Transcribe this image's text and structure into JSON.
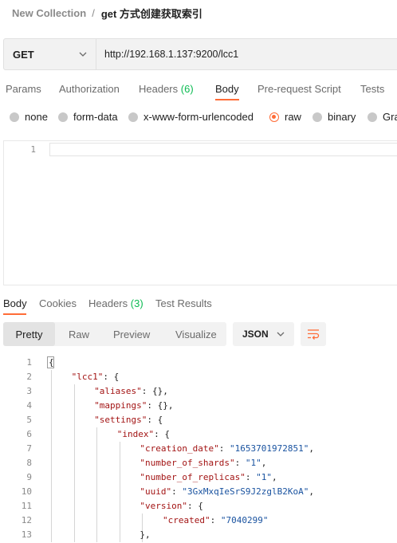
{
  "breadcrumb": {
    "parent": "New Collection",
    "separator": "/",
    "current": "get 方式创建获取索引"
  },
  "request": {
    "method": "GET",
    "url": "http://192.168.1.137:9200/lcc1"
  },
  "request_tabs": [
    {
      "label": "Params"
    },
    {
      "label": "Authorization"
    },
    {
      "label": "Headers",
      "count": "(6)"
    },
    {
      "label": "Body",
      "active": true
    },
    {
      "label": "Pre-request Script"
    },
    {
      "label": "Tests"
    }
  ],
  "body_types": [
    {
      "label": "none"
    },
    {
      "label": "form-data"
    },
    {
      "label": "x-www-form-urlencoded"
    },
    {
      "label": "raw",
      "selected": true
    },
    {
      "label": "binary"
    },
    {
      "label": "Gra"
    }
  ],
  "editor": {
    "line_number": "1"
  },
  "response_tabs": [
    {
      "label": "Body",
      "active": true
    },
    {
      "label": "Cookies"
    },
    {
      "label": "Headers",
      "count": "(3)"
    },
    {
      "label": "Test Results"
    }
  ],
  "view_modes": [
    {
      "label": "Pretty",
      "active": true
    },
    {
      "label": "Raw"
    },
    {
      "label": "Preview"
    },
    {
      "label": "Visualize"
    }
  ],
  "format": "JSON",
  "colors": {
    "accent": "#ff6c37",
    "count_green": "#0cbb52",
    "json_key": "#a31515",
    "json_string": "#1a53a0"
  },
  "response_lines": [
    {
      "n": "1",
      "indent": 0,
      "tokens": [
        {
          "t": "p",
          "v": "{"
        }
      ]
    },
    {
      "n": "2",
      "indent": 1,
      "tokens": [
        {
          "t": "k",
          "v": "\"lcc1\""
        },
        {
          "t": "p",
          "v": ": {"
        }
      ]
    },
    {
      "n": "3",
      "indent": 2,
      "tokens": [
        {
          "t": "k",
          "v": "\"aliases\""
        },
        {
          "t": "p",
          "v": ": {},"
        }
      ]
    },
    {
      "n": "4",
      "indent": 2,
      "tokens": [
        {
          "t": "k",
          "v": "\"mappings\""
        },
        {
          "t": "p",
          "v": ": {},"
        }
      ]
    },
    {
      "n": "5",
      "indent": 2,
      "tokens": [
        {
          "t": "k",
          "v": "\"settings\""
        },
        {
          "t": "p",
          "v": ": {"
        }
      ]
    },
    {
      "n": "6",
      "indent": 3,
      "tokens": [
        {
          "t": "k",
          "v": "\"index\""
        },
        {
          "t": "p",
          "v": ": {"
        }
      ]
    },
    {
      "n": "7",
      "indent": 4,
      "tokens": [
        {
          "t": "k",
          "v": "\"creation_date\""
        },
        {
          "t": "p",
          "v": ": "
        },
        {
          "t": "s",
          "v": "\"1653701972851\""
        },
        {
          "t": "p",
          "v": ","
        }
      ]
    },
    {
      "n": "8",
      "indent": 4,
      "tokens": [
        {
          "t": "k",
          "v": "\"number_of_shards\""
        },
        {
          "t": "p",
          "v": ": "
        },
        {
          "t": "s",
          "v": "\"1\""
        },
        {
          "t": "p",
          "v": ","
        }
      ]
    },
    {
      "n": "9",
      "indent": 4,
      "tokens": [
        {
          "t": "k",
          "v": "\"number_of_replicas\""
        },
        {
          "t": "p",
          "v": ": "
        },
        {
          "t": "s",
          "v": "\"1\""
        },
        {
          "t": "p",
          "v": ","
        }
      ]
    },
    {
      "n": "10",
      "indent": 4,
      "tokens": [
        {
          "t": "k",
          "v": "\"uuid\""
        },
        {
          "t": "p",
          "v": ": "
        },
        {
          "t": "s",
          "v": "\"3GxMxqIeSrS9J2zglB2KoA\""
        },
        {
          "t": "p",
          "v": ","
        }
      ]
    },
    {
      "n": "11",
      "indent": 4,
      "tokens": [
        {
          "t": "k",
          "v": "\"version\""
        },
        {
          "t": "p",
          "v": ": {"
        }
      ]
    },
    {
      "n": "12",
      "indent": 5,
      "tokens": [
        {
          "t": "k",
          "v": "\"created\""
        },
        {
          "t": "p",
          "v": ": "
        },
        {
          "t": "s",
          "v": "\"7040299\""
        }
      ]
    },
    {
      "n": "13",
      "indent": 4,
      "tokens": [
        {
          "t": "p",
          "v": "},"
        }
      ]
    }
  ]
}
